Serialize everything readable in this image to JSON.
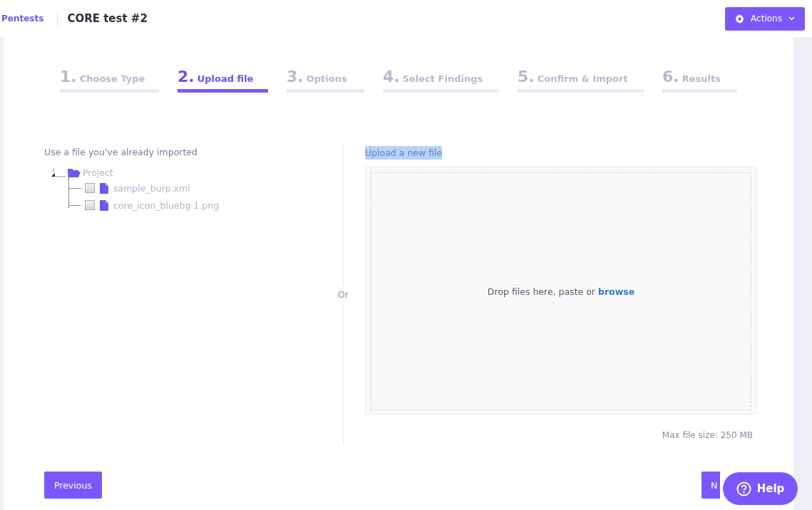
{
  "header": {
    "breadcrumb": "Pentests",
    "title": "CORE test #2",
    "actions_button": "Actions"
  },
  "steps": [
    {
      "number": "1.",
      "label": "Choose Type",
      "selected": false
    },
    {
      "number": "2.",
      "label": "Upload file",
      "selected": true
    },
    {
      "number": "3.",
      "label": "Options",
      "selected": false
    },
    {
      "number": "4.",
      "label": "Select Findings",
      "selected": false
    },
    {
      "number": "5.",
      "label": "Confirm & Import",
      "selected": false
    },
    {
      "number": "6.",
      "label": "Results",
      "selected": false
    }
  ],
  "existing": {
    "heading": "Use a file you've already imported",
    "tree": [
      {
        "label": "Project",
        "expanded": true,
        "children": [
          {
            "label": "sample_burp.xml",
            "checked": false
          },
          {
            "label": "core_icon_bluebg 1.png",
            "checked": false
          }
        ]
      }
    ]
  },
  "divider_label": "Or",
  "upload": {
    "heading": "Upload a new file",
    "heading_selected": true,
    "drop_text": "Drop files here, paste or",
    "browse_link": "browse",
    "max_size": "Max file size: 250 MB"
  },
  "buttons": {
    "previous": "Previous",
    "next": "N"
  },
  "help_button": "Help"
}
